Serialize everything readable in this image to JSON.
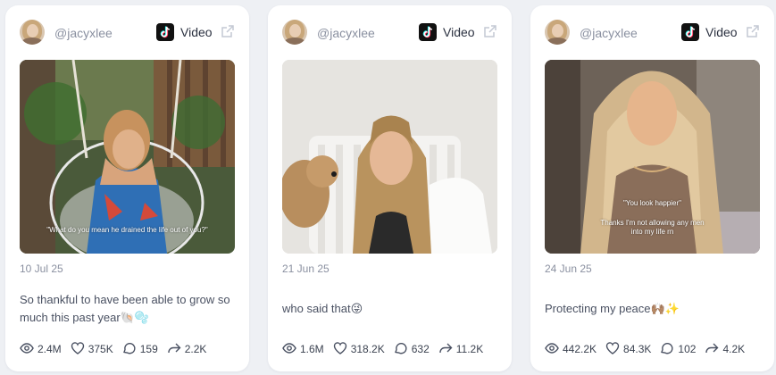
{
  "posts": [
    {
      "username": "@jacyxlee",
      "platform_icon": "tiktok-icon",
      "type_label": "Video",
      "thumb_caption": "\"What do you mean he drained the life out of you?\"",
      "date": "10 Jul 25",
      "description": "So thankful to have been able to grow so much this past year🐚🫧",
      "views": "2.4M",
      "likes": "375K",
      "comments": "159",
      "shares": "2.2K"
    },
    {
      "username": "@jacyxlee",
      "platform_icon": "tiktok-icon",
      "type_label": "Video",
      "thumb_caption": "",
      "date": "21 Jun 25",
      "description": "who said that😜",
      "views": "1.6M",
      "likes": "318.2K",
      "comments": "632",
      "shares": "11.2K"
    },
    {
      "username": "@jacyxlee",
      "platform_icon": "tiktok-icon",
      "type_label": "Video",
      "thumb_caption_line1": "\"You look happier\"",
      "thumb_caption_line2": "Thanks I'm not allowing any men into my life rn",
      "date": "24 Jun 25",
      "description": "Protecting my peace🙌🏽✨",
      "views": "442.2K",
      "likes": "84.3K",
      "comments": "102",
      "shares": "4.2K"
    }
  ],
  "colors": {
    "page_bg": "#eef0f4",
    "card_bg": "#ffffff",
    "muted_text": "#8a90a0"
  }
}
